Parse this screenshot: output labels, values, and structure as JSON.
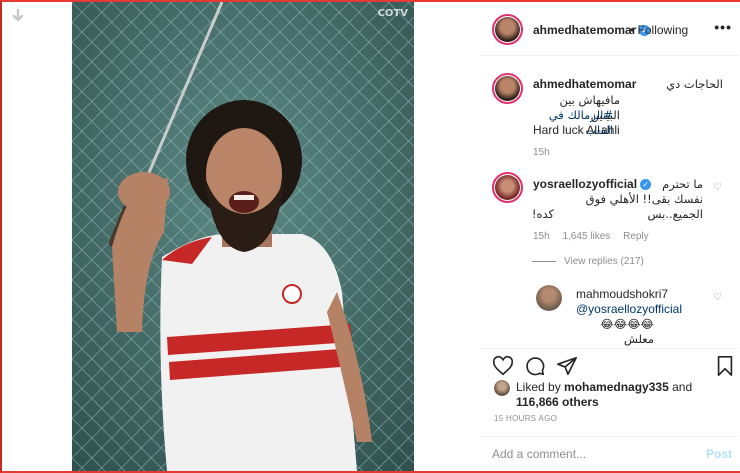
{
  "post": {
    "author": "ahmedhatemomar",
    "follow_status": "• Following",
    "more_glyph": "•••",
    "watermark": "COTV"
  },
  "caption": {
    "author": "ahmedhatemomar",
    "line1": "الحاجات دي",
    "line2": "مافيهاش بين البينين",
    "hashtag": "#الزمالك في القلب",
    "line4": "Hard luck Al-ahli",
    "time": "15h"
  },
  "comments": [
    {
      "author": "yosraellozyofficial",
      "text_line1": "ما تحترم",
      "text_line2": "نفسك بقى!! الأهلي فوق الجميع..بس",
      "text_line3": "كده!",
      "time": "15h",
      "likes": "1,645 likes",
      "reply": "Reply"
    }
  ],
  "view_replies": "View replies (217)",
  "reply": {
    "author": "mahmoudshokri7",
    "mention": "@yosraellozyofficial",
    "text": "😂😂😂😂 معلش"
  },
  "likes": {
    "prefix": "Liked by",
    "user": "mohamednagy335",
    "and": "and",
    "count": "116,866 others"
  },
  "time_ago": "15 HOURS AGO",
  "comment_box": {
    "placeholder": "Add a comment...",
    "post_label": "Post"
  },
  "colors": {
    "verified": "#3897f0",
    "link": "#00376b",
    "frame": "#e53935"
  }
}
